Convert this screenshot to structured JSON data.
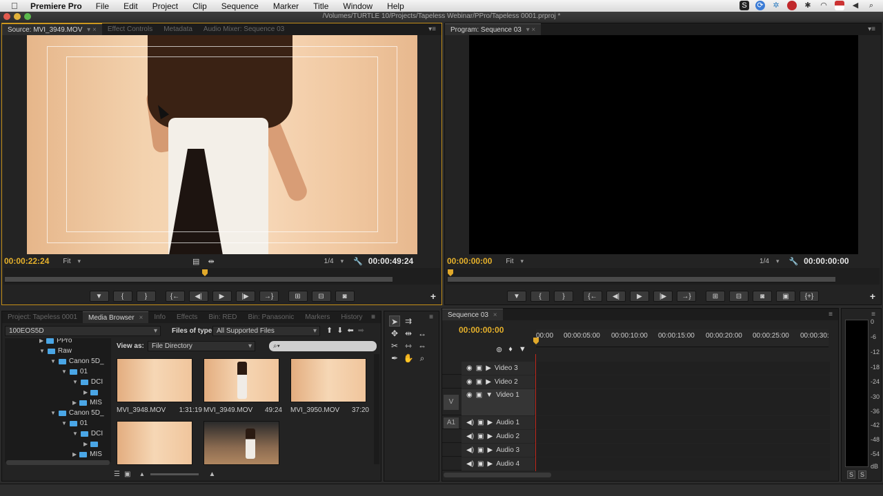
{
  "menubar": {
    "app_name": "Premiere Pro",
    "items": [
      "File",
      "Edit",
      "Project",
      "Clip",
      "Sequence",
      "Marker",
      "Title",
      "Window",
      "Help"
    ]
  },
  "window": {
    "title": "/Volumes/TURTLE 10/Projects/Tapeless Webinar/PPro/Tapeless 0001.prproj *"
  },
  "source_monitor": {
    "tabs": [
      "Source: MVI_3949.MOV",
      "Effect Controls",
      "Metadata",
      "Audio Mixer: Sequence 03"
    ],
    "current_tc": "00:00:22:24",
    "zoom": "Fit",
    "resolution": "1/4",
    "duration_tc": "00:00:49:24",
    "playhead_fraction": 0.46
  },
  "program_monitor": {
    "tab": "Program: Sequence 03",
    "current_tc": "00:00:00:00",
    "zoom": "Fit",
    "resolution": "1/4",
    "duration_tc": "00:00:00:00"
  },
  "project_panel": {
    "tabs": [
      "Project: Tapeless 0001",
      "Media Browser",
      "Info",
      "Effects",
      "Bin: RED",
      "Bin: Panasonic",
      "Markers",
      "History"
    ],
    "path": "100EOS5D",
    "files_of_type_label": "Files of type:",
    "files_of_type_value": "All Supported Files",
    "view_as_label": "View as:",
    "view_as_value": "File Directory",
    "tree": [
      {
        "label": "PPro",
        "depth": 2
      },
      {
        "label": "Raw",
        "depth": 2
      },
      {
        "label": "Canon 5D_",
        "depth": 3
      },
      {
        "label": "01",
        "depth": 4
      },
      {
        "label": "DCI",
        "depth": 5
      },
      {
        "label": "",
        "depth": 6
      },
      {
        "label": "MIS",
        "depth": 5
      },
      {
        "label": "Canon 5D_",
        "depth": 3
      },
      {
        "label": "01",
        "depth": 4
      },
      {
        "label": "DCI",
        "depth": 5
      },
      {
        "label": "",
        "depth": 6
      },
      {
        "label": "MIS",
        "depth": 5
      }
    ],
    "clips": [
      {
        "name": "MVI_3948.MOV",
        "duration": "1:31:19"
      },
      {
        "name": "MVI_3949.MOV",
        "duration": "49:24"
      },
      {
        "name": "MVI_3950.MOV",
        "duration": "37:20"
      },
      {
        "name": "",
        "duration": ""
      },
      {
        "name": "",
        "duration": ""
      }
    ]
  },
  "timeline": {
    "tab": "Sequence 03",
    "current_tc": "00:00:00:00",
    "ruler": [
      "00:00",
      "00:00:05:00",
      "00:00:10:00",
      "00:00:15:00",
      "00:00:20:00",
      "00:00:25:00",
      "00:00:30:"
    ],
    "tracks": [
      {
        "name": "Video 3",
        "src": ""
      },
      {
        "name": "Video 2",
        "src": ""
      },
      {
        "name": "Video 1",
        "src": "V"
      },
      {
        "name": "Audio 1",
        "src": "A1"
      },
      {
        "name": "Audio 2",
        "src": ""
      },
      {
        "name": "Audio 3",
        "src": ""
      },
      {
        "name": "Audio 4",
        "src": ""
      }
    ]
  },
  "meter": {
    "scale": [
      "0",
      "-6",
      "-12",
      "-18",
      "-24",
      "-30",
      "-36",
      "-42",
      "-48",
      "-54",
      "dB"
    ],
    "solo_left": "S",
    "solo_right": "S"
  },
  "colors": {
    "timecode": "#e6b12b",
    "active_border": "#c69018",
    "playhead_line": "#c3281c"
  }
}
